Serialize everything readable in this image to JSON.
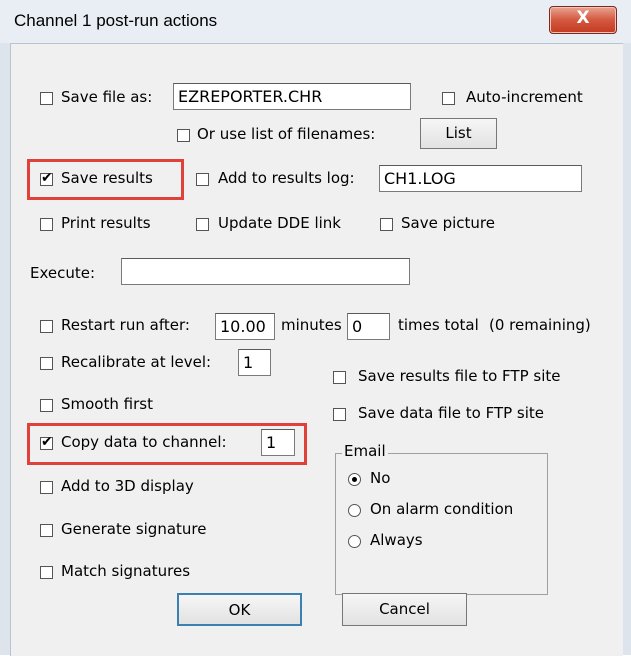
{
  "window": {
    "title": "Channel 1 post-run actions",
    "close_label": "X"
  },
  "save_file": {
    "label": "Save file as:",
    "value": "EZREPORTER.CHR",
    "checked": false
  },
  "auto_increment": {
    "label": "Auto-increment",
    "checked": false
  },
  "filename_list": {
    "label": "Or use list of filenames:",
    "button": "List",
    "checked": false
  },
  "save_results": {
    "label": "Save results",
    "checked": true
  },
  "results_log": {
    "label": "Add to results log:",
    "value": "CH1.LOG",
    "checked": false
  },
  "print_results": {
    "label": "Print results",
    "checked": false
  },
  "update_dde": {
    "label": "Update DDE link",
    "checked": false
  },
  "save_picture": {
    "label": "Save picture",
    "checked": false
  },
  "execute": {
    "label": "Execute:",
    "value": ""
  },
  "restart": {
    "label": "Restart run after:",
    "minutes_value": "10.00",
    "minutes_label": "minutes",
    "times_value": "0",
    "times_label": "times total",
    "remaining": "(0 remaining)",
    "checked": false
  },
  "recalibrate": {
    "label": "Recalibrate at level:",
    "value": "1",
    "checked": false
  },
  "ftp_results": {
    "label": "Save results file to FTP site",
    "checked": false
  },
  "smooth_first": {
    "label": "Smooth first",
    "checked": false
  },
  "ftp_data": {
    "label": "Save data file to FTP site",
    "checked": false
  },
  "copy_data": {
    "label": "Copy data to channel:",
    "value": "1",
    "checked": true
  },
  "add_3d": {
    "label": "Add to 3D display",
    "checked": false
  },
  "generate_signature": {
    "label": "Generate signature",
    "checked": false
  },
  "match_signatures": {
    "label": "Match signatures",
    "checked": false
  },
  "email": {
    "group_label": "Email",
    "options": [
      "No",
      "On alarm condition",
      "Always"
    ],
    "selected": "No"
  },
  "buttons": {
    "ok": "OK",
    "cancel": "Cancel"
  },
  "colors": {
    "highlight": "#e0413a",
    "close_button": "#c23b22"
  }
}
